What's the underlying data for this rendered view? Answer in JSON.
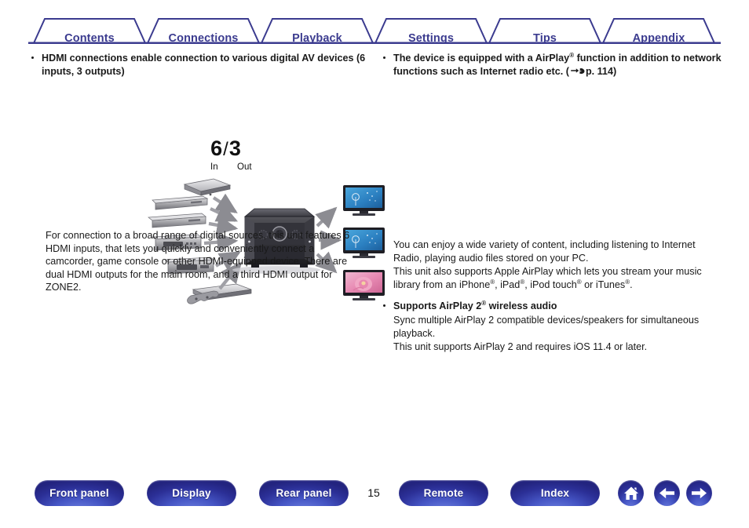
{
  "tabs": [
    {
      "label": "Contents",
      "name": "tab-contents"
    },
    {
      "label": "Connections",
      "name": "tab-connections"
    },
    {
      "label": "Playback",
      "name": "tab-playback"
    },
    {
      "label": "Settings",
      "name": "tab-settings"
    },
    {
      "label": "Tips",
      "name": "tab-tips"
    },
    {
      "label": "Appendix",
      "name": "tab-appendix"
    }
  ],
  "left": {
    "bullet": "HDMI connections enable connection to various digital AV devices (6 inputs, 3 outputs)",
    "diagram": {
      "in_count": "6",
      "separator": "/",
      "out_count": "3",
      "in_label": "In",
      "out_label": "Out"
    },
    "body": "For connection to a broad range of digital sources, this unit features 6 HDMI inputs, that lets you quickly and conveniently connect a camcorder, game console or other HDMI-equipped device. There are dual HDMI outputs for the main room, and a third HDMI output for ZONE2."
  },
  "right": {
    "bullet_pre": "The device is equipped with a AirPlay",
    "bullet_sup": "®",
    "bullet_mid": " function in addition to network functions such as Internet radio etc.  (",
    "bullet_ref": "p. 114)",
    "body_p1": "You can enjoy a wide variety of content, including listening to Internet Radio, playing audio files stored on your PC.",
    "body_p2_a": "This unit also supports Apple AirPlay which lets you stream your music library from an iPhone",
    "body_p2_b": ", iPad",
    "body_p2_c": ", iPod touch",
    "body_p2_d": " or iTunes",
    "body_p2_e": ".",
    "sup": "®",
    "bullet2_pre": "Supports AirPlay 2",
    "bullet2_sup": "®",
    "bullet2_post": " wireless audio",
    "bullet2_body1": "Sync multiple AirPlay 2 compatible devices/speakers for simultaneous playback.",
    "bullet2_body2": "This unit supports AirPlay 2 and requires iOS 11.4 or later."
  },
  "bottom": {
    "page_number": "15",
    "buttons": [
      {
        "label": "Front panel",
        "name": "front-panel-button"
      },
      {
        "label": "Display",
        "name": "display-button"
      },
      {
        "label": "Rear panel",
        "name": "rear-panel-button"
      },
      {
        "label": "Remote",
        "name": "remote-button"
      },
      {
        "label": "Index",
        "name": "index-button"
      }
    ],
    "icons": [
      {
        "name": "home-icon"
      },
      {
        "name": "back-arrow-icon"
      },
      {
        "name": "forward-arrow-icon"
      }
    ]
  },
  "colors": {
    "tab_blue": "#3b3b8f",
    "pill_blue": "#2b2f96",
    "text": "#1a1a1a"
  }
}
